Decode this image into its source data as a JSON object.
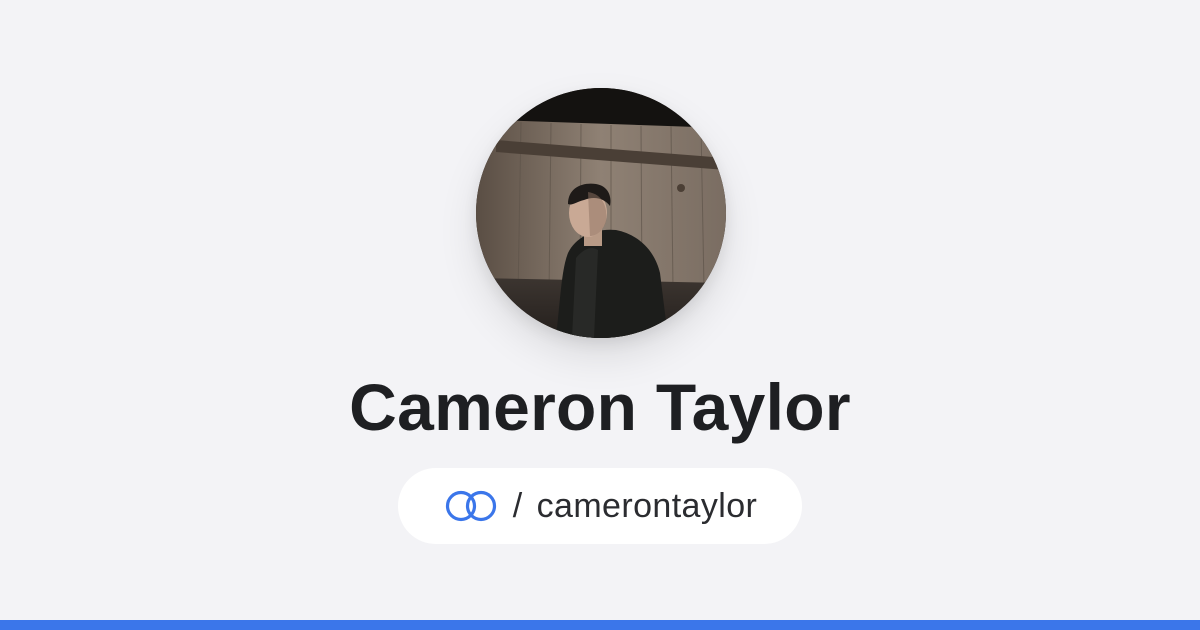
{
  "profile": {
    "name": "Cameron Taylor",
    "handle_separator": "/",
    "handle": "camerontaylor",
    "avatar_alt": "profile-photo"
  },
  "brand": {
    "icon": "linked-rings-icon",
    "accent_color": "#3b76ea"
  }
}
